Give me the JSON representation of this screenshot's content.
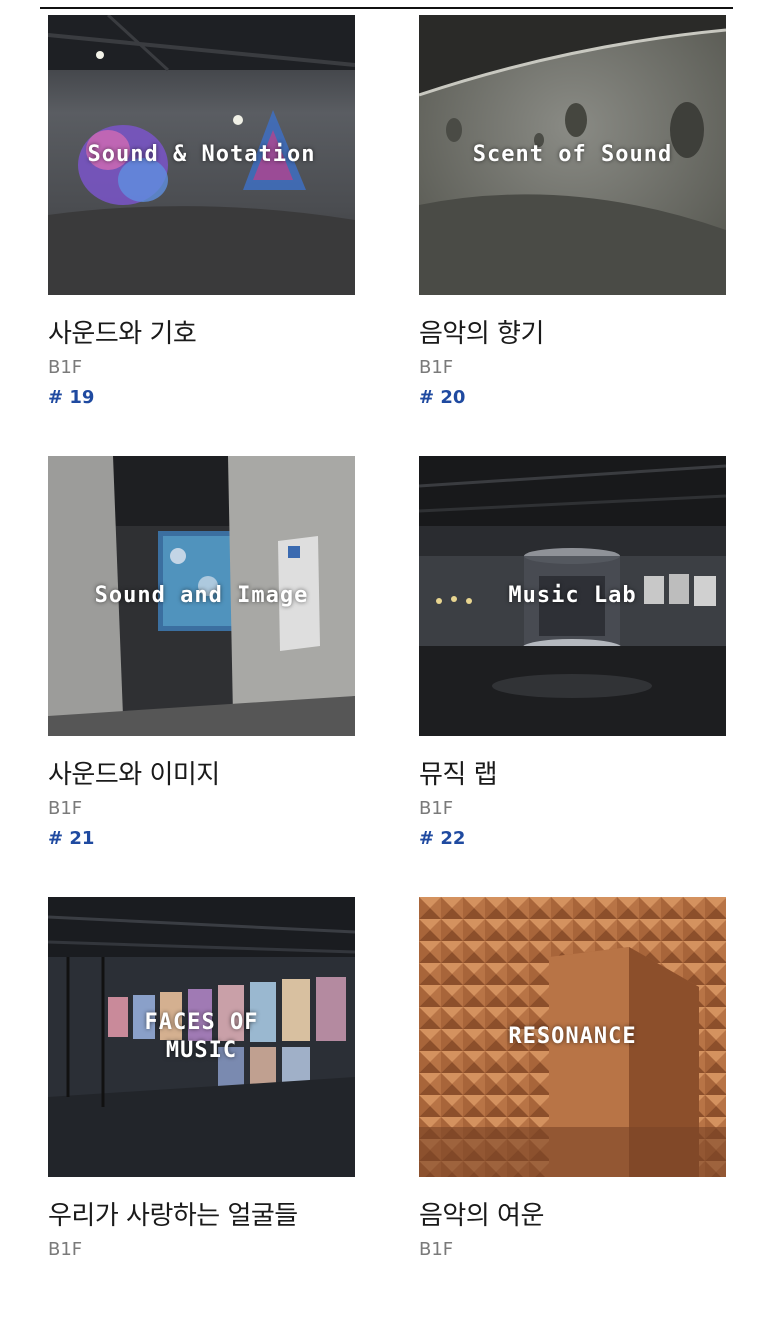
{
  "exhibits": [
    {
      "label": "Sound & Notation",
      "title": "사운드와 기호",
      "floor": "B1F",
      "number": "# 19",
      "theme": "gallery-dark",
      "colors": {
        "base": "#4a4d52",
        "floor": "#3b3b3c",
        "accent": "#7a55c9"
      }
    },
    {
      "label": "Scent of Sound",
      "title": "음악의 향기",
      "floor": "B1F",
      "number": "# 20",
      "theme": "concrete-curve",
      "colors": {
        "base": "#6f706b",
        "floor": "#5c5c57",
        "accent": "#8a8b85"
      }
    },
    {
      "label": "Sound and Image",
      "title": "사운드와 이미지",
      "floor": "B1F",
      "number": "# 21",
      "theme": "projection-room",
      "colors": {
        "base": "#2f3033",
        "floor": "#4a4a4a",
        "accent": "#5aa3c9"
      }
    },
    {
      "label": "Music Lab",
      "title": "뮤직 랩",
      "floor": "B1F",
      "number": "# 22",
      "theme": "lab-hall",
      "colors": {
        "base": "#2a2c30",
        "floor": "#1d1e20",
        "accent": "#b4b8be"
      }
    },
    {
      "label": "FACES OF\nMUSIC",
      "title": "우리가 사랑하는 얼굴들",
      "floor": "B1F",
      "number": "",
      "theme": "portrait-wall",
      "colors": {
        "base": "#2b2f36",
        "floor": "#22252a",
        "accent": "#c98a9a"
      }
    },
    {
      "label": "RESONANCE",
      "title": "음악의 여운",
      "floor": "B1F",
      "number": "",
      "theme": "acoustic-room",
      "colors": {
        "base": "#a8653a",
        "floor": "#8c4f2b",
        "accent": "#d4925f"
      }
    }
  ]
}
